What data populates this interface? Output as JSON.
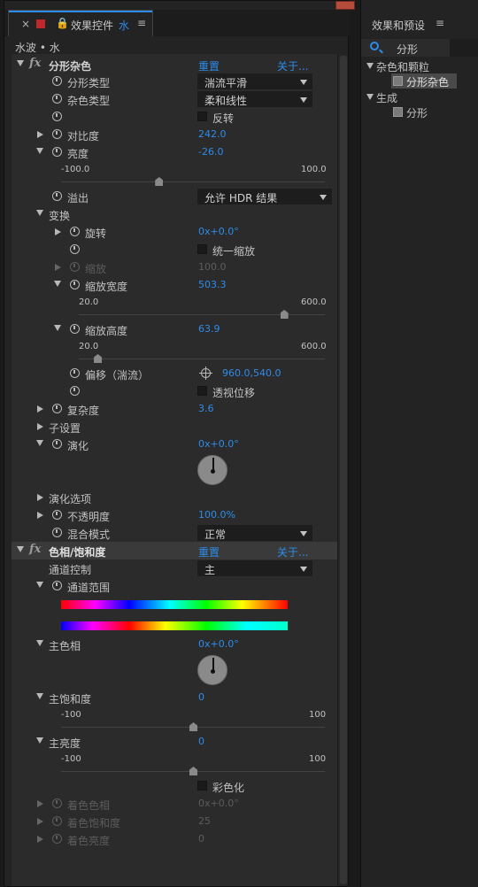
{
  "left_panel": {
    "tab": {
      "close": "×",
      "lock": "🔒",
      "title": "效果控件",
      "comp": "水",
      "menu": "≡"
    },
    "subheader": "水波 • 水"
  },
  "fractal": {
    "name": "分形杂色",
    "reset": "重置",
    "about": "关于...",
    "fractal_type_label": "分形类型",
    "fractal_type_value": "湍流平滑",
    "noise_type_label": "杂色类型",
    "noise_type_value": "柔和线性",
    "invert_label": "反转",
    "contrast_label": "对比度",
    "contrast_value": "242.0",
    "brightness_label": "亮度",
    "brightness_value": "-26.0",
    "brightness_min": "-100.0",
    "brightness_max": "100.0",
    "brightness_level": -26,
    "overflow_label": "溢出",
    "overflow_value": "允许 HDR 结果",
    "transform_label": "变换",
    "rotation_label": "旋转",
    "rotation_value": "0x+0.0°",
    "uniform_scale_label": "统一缩放",
    "scale_label": "缩放",
    "scale_value": "100.0",
    "scale_width_label": "缩放宽度",
    "scale_width_value": "503.3",
    "scale_width_min": "20.0",
    "scale_width_max": "600.0",
    "scale_width_level": 503.3,
    "scale_height_label": "缩放高度",
    "scale_height_value": "63.9",
    "scale_height_min": "20.0",
    "scale_height_max": "600.0",
    "scale_height_level": 63.9,
    "offset_label": "偏移（湍流）",
    "offset_value": "960.0,540.0",
    "perspective_label": "透视位移",
    "complexity_label": "复杂度",
    "complexity_value": "3.6",
    "sub_settings_label": "子设置",
    "evolution_label": "演化",
    "evolution_value": "0x+0.0°",
    "evolution_options_label": "演化选项",
    "opacity_label": "不透明度",
    "opacity_value": "100.0%",
    "blend_mode_label": "混合模式",
    "blend_mode_value": "正常"
  },
  "hue": {
    "name": "色相/饱和度",
    "reset": "重置",
    "about": "关于...",
    "channel_control_label": "通道控制",
    "channel_control_value": "主",
    "channel_range_label": "通道范围",
    "master_hue_label": "主色相",
    "master_hue_value": "0x+0.0°",
    "master_sat_label": "主饱和度",
    "master_sat_value": "0",
    "master_sat_min": "-100",
    "master_sat_max": "100",
    "master_sat_level": 0,
    "master_light_label": "主亮度",
    "master_light_value": "0",
    "master_light_min": "-100",
    "master_light_max": "100",
    "master_light_level": 0,
    "colorize_label": "彩色化",
    "colorize_hue_label": "着色色相",
    "colorize_hue_value": "0x+0.0°",
    "colorize_sat_label": "着色饱和度",
    "colorize_sat_value": "25",
    "colorize_light_label": "着色亮度",
    "colorize_light_value": "0"
  },
  "right_panel": {
    "title": "效果和预设",
    "menu": "≡",
    "search_value": "分形",
    "group1": "杂色和颗粒",
    "item1": "分形杂色",
    "group2": "生成",
    "item2": "分形"
  },
  "colors": {
    "accent": "#2d8ceb",
    "bg": "#232323",
    "panel": "#2b2b2b"
  }
}
